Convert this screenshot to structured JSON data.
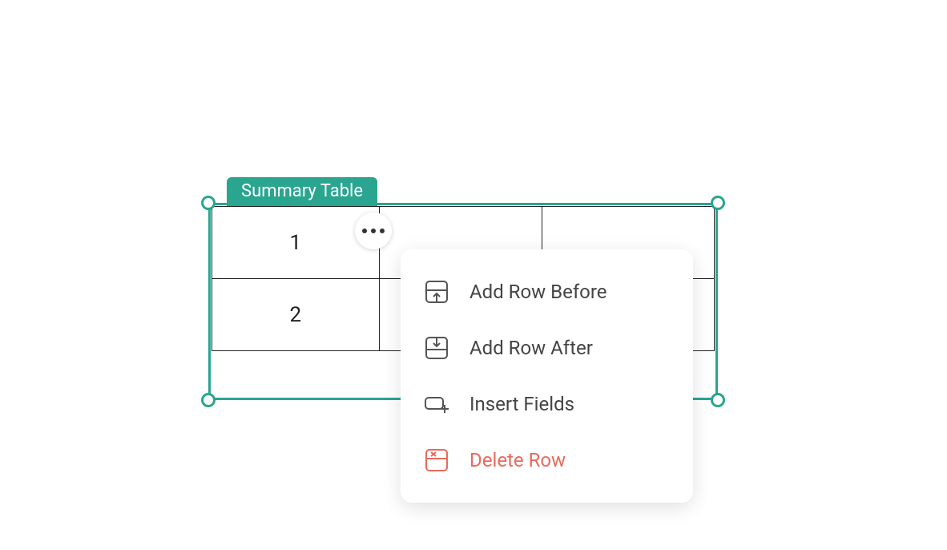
{
  "table": {
    "label": "Summary Table",
    "rows": [
      {
        "cells": [
          "1",
          "",
          ""
        ]
      },
      {
        "cells": [
          "2",
          "",
          ""
        ]
      }
    ]
  },
  "menu": {
    "add_before": "Add Row Before",
    "add_after": "Add Row After",
    "insert_fields": "Insert Fields",
    "delete_row": "Delete Row"
  }
}
